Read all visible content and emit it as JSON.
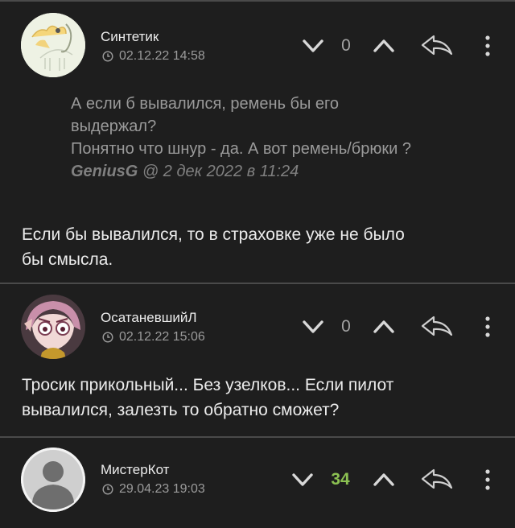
{
  "comments": [
    {
      "username": "Синтетик",
      "date": "02.12.22 14:58",
      "score": "0",
      "quote": {
        "lines": [
          "А если б вывалился, ремень бы его",
          "выдержал?",
          "Понятно что шнур - да. А вот ремень/брюки ?"
        ],
        "author": "GeniusG",
        "at": "@",
        "time": "2 дек 2022 в 11:24"
      },
      "text_lines": [
        "Если бы вывалился, то в страховке уже не было",
        "бы смысла."
      ]
    },
    {
      "username": "ОсатаневшийЛ",
      "date": "02.12.22 15:06",
      "score": "0",
      "text_lines": [
        "Тросик прикольный... Без узелков... Если пилот",
        "вывалился, залезть то обратно сможет?"
      ]
    },
    {
      "username": "МистерКот",
      "date": "29.04.23 19:03",
      "score": "34"
    }
  ],
  "colors": {
    "background": "#1e1e1e",
    "positive_score": "#8cc152",
    "divider": "#4a4a4a"
  },
  "icons": [
    "clock-icon",
    "chevron-down-icon",
    "chevron-up-icon",
    "reply-icon",
    "more-vertical-icon"
  ]
}
